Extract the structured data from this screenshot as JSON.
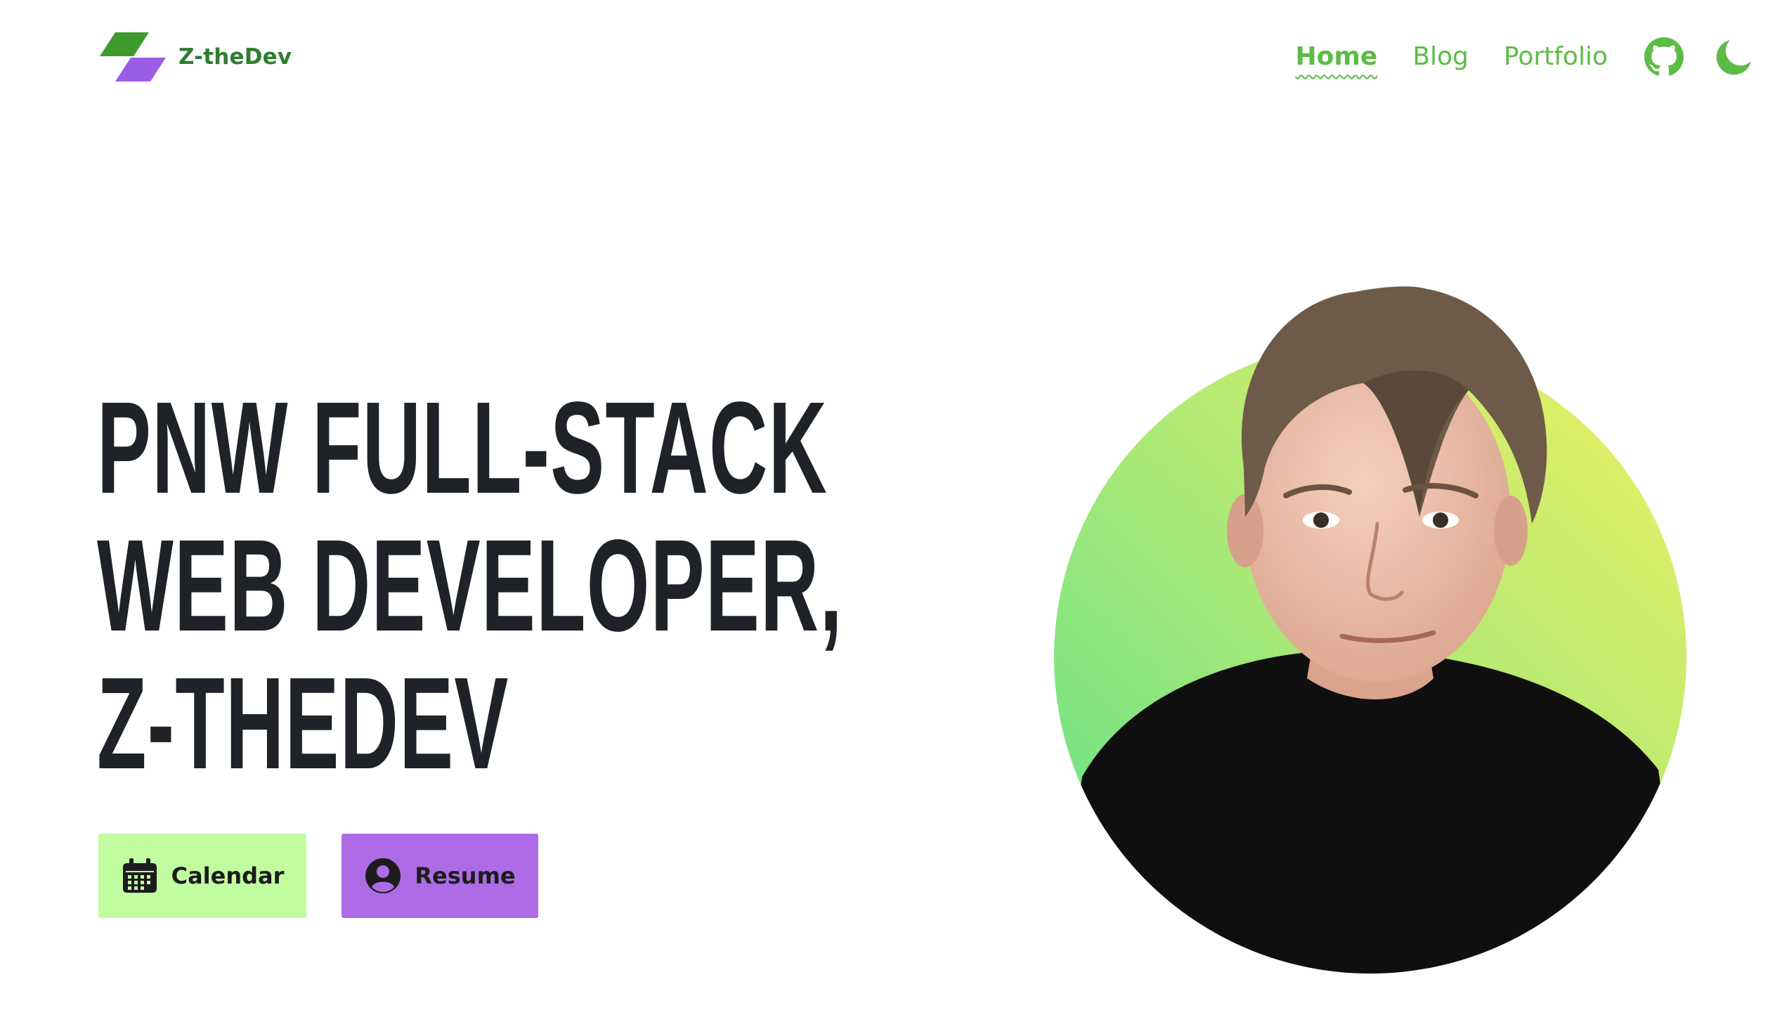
{
  "header": {
    "brand_name": "Z-theDev",
    "nav": {
      "home": "Home",
      "blog": "Blog",
      "portfolio": "Portfolio"
    },
    "icons": [
      "github-icon",
      "moon-icon"
    ]
  },
  "hero": {
    "title_lines": [
      "PNW FULL-STACK",
      "WEB DEVELOPER,",
      "Z-THEDEV"
    ],
    "buttons": {
      "calendar": "Calendar",
      "resume": "Resume"
    }
  },
  "colors": {
    "accent_green": "#5cbc45",
    "brand_green": "#2e7d32",
    "logo_purple": "#9b5de5",
    "calendar_button": "#c2fca1",
    "resume_button": "#ad6ce6",
    "title": "#1f2328"
  }
}
